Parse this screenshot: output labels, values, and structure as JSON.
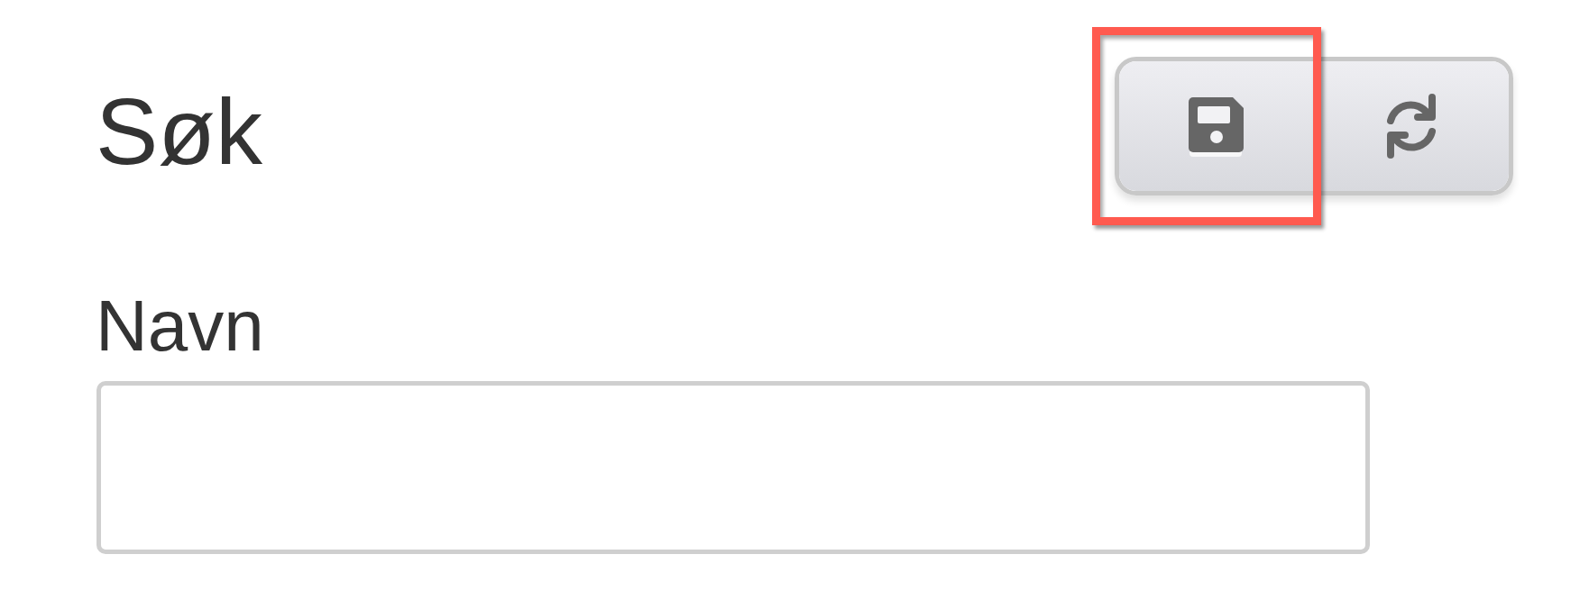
{
  "title": "Søk",
  "toolbar": {
    "buttons": [
      {
        "kind": "save",
        "highlighted": true
      },
      {
        "kind": "refresh",
        "highlighted": false
      }
    ]
  },
  "fields": [
    {
      "label": "Navn"
    }
  ]
}
